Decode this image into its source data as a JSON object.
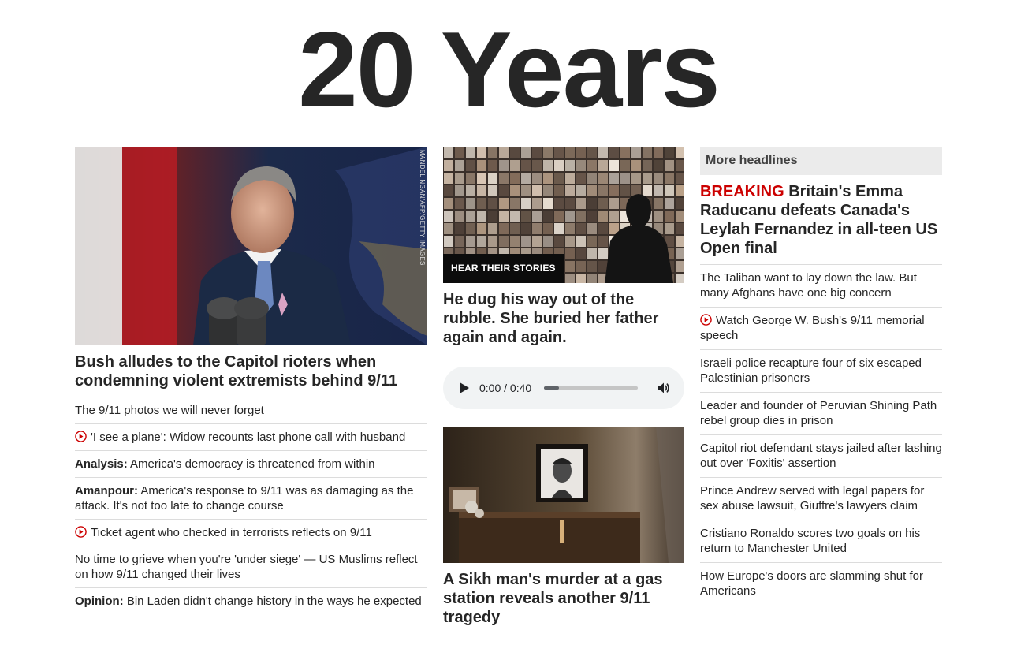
{
  "page_title": "20 Years",
  "left": {
    "hero_photo_credit": "MANDEL NGAN/AFP/GETTY IMAGES",
    "hero_headline": "Bush alludes to the Capitol rioters when condemning violent extremists behind 9/11",
    "stories": [
      {
        "kicker": "",
        "text": "The 9/11 photos we will never forget",
        "video": false
      },
      {
        "kicker": "",
        "text": "'I see a plane': Widow recounts last phone call with husband",
        "video": true
      },
      {
        "kicker": "Analysis:",
        "text": "America's democracy is threatened from within",
        "video": false
      },
      {
        "kicker": "Amanpour:",
        "text": "America's response to 9/11 was as damaging as the attack. It's not too late to change course",
        "video": false
      },
      {
        "kicker": "",
        "text": "Ticket agent who checked in terrorists reflects on 9/11",
        "video": true
      },
      {
        "kicker": "",
        "text": "No time to grieve when you're 'under siege' — US Muslims reflect on how 9/11 changed their lives",
        "video": false
      },
      {
        "kicker": "Opinion:",
        "text": "Bin Laden didn't change history in the ways he expected",
        "video": false
      }
    ]
  },
  "middle": {
    "photo_label": "HEAR THEIR STORIES",
    "headline_1": "He dug his way out of the rubble. She buried her father again and again.",
    "audio": {
      "time": "0:00 / 0:40",
      "progress": 0.16
    },
    "headline_2": "A Sikh man's murder at a gas station reveals another 9/11 tragedy"
  },
  "right": {
    "section_title": "More headlines",
    "breaking_label": "BREAKING",
    "breaking_text": "Britain's Emma Raducanu defeats Canada's Leylah Fernandez in all-teen US Open final",
    "headlines": [
      {
        "text": "The Taliban want to lay down the law. But many Afghans have one big concern",
        "video": false
      },
      {
        "text": "Watch George W. Bush's 9/11 memorial speech",
        "video": true
      },
      {
        "text": "Israeli police recapture four of six escaped Palestinian prisoners",
        "video": false
      },
      {
        "text": "Leader and founder of Peruvian Shining Path rebel group dies in prison",
        "video": false
      },
      {
        "text": "Capitol riot defendant stays jailed after lashing out over 'Foxitis' assertion",
        "video": false
      },
      {
        "text": "Prince Andrew served with legal papers for sex abuse lawsuit, Giuffre's lawyers claim",
        "video": false
      },
      {
        "text": "Cristiano Ronaldo scores two goals on his return to Manchester United",
        "video": false
      },
      {
        "text": "How Europe's doors are slamming shut for Americans",
        "video": false
      }
    ]
  },
  "colors": {
    "breaking": "#cc0000",
    "video_icon": "#cc0000",
    "text": "#262626",
    "divider": "#dcdcdc"
  },
  "icons": {
    "video": "play-circle-icon",
    "audio_play": "play-icon",
    "audio_volume": "volume-icon"
  }
}
